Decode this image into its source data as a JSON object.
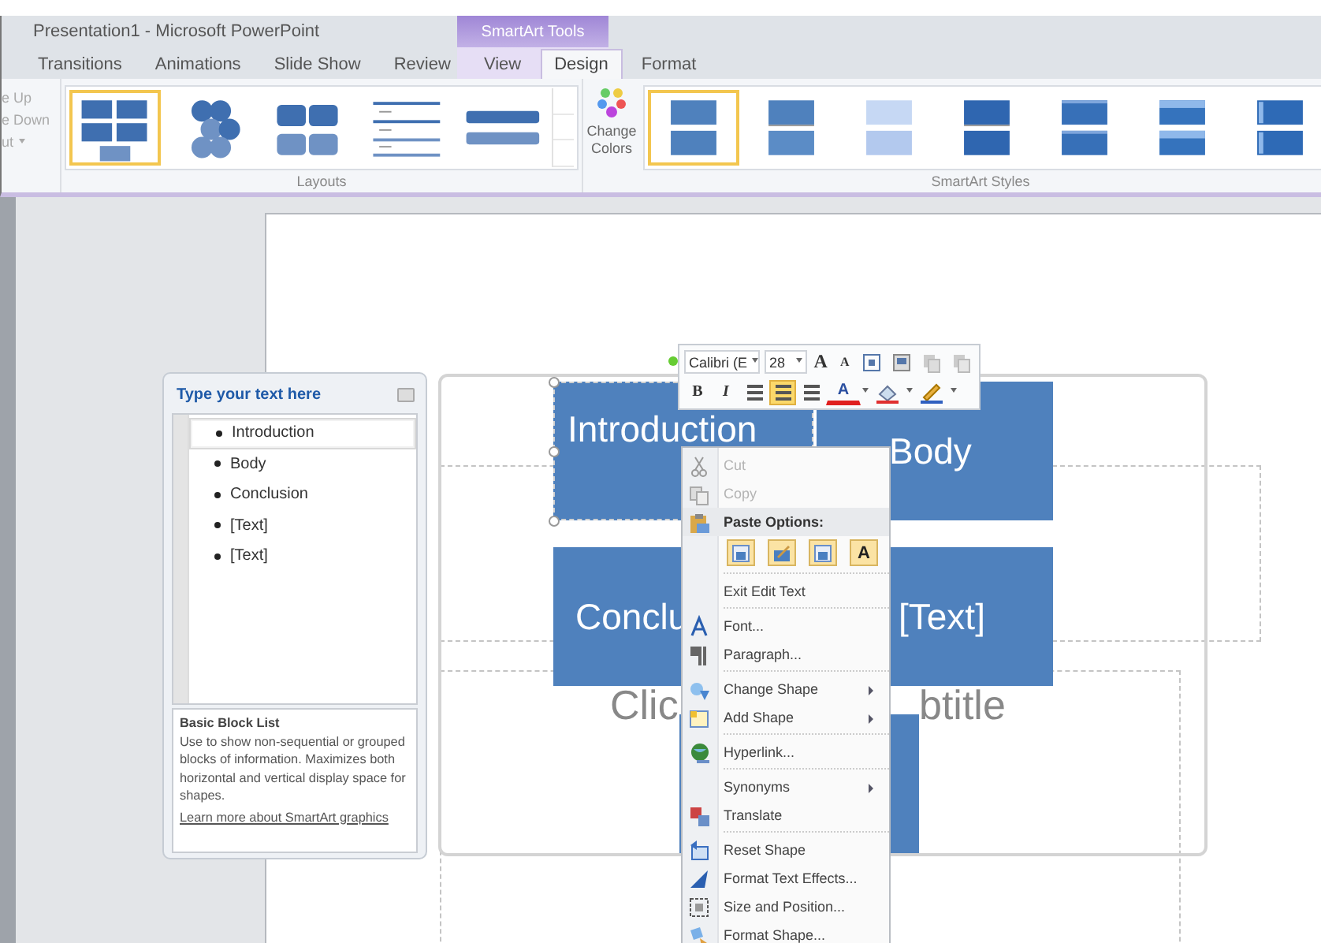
{
  "window": {
    "title": "Presentation1 - Microsoft PowerPoint",
    "context_group": "SmartArt Tools"
  },
  "tabs": [
    {
      "label": "Transitions",
      "selected": false
    },
    {
      "label": "Animations",
      "selected": false
    },
    {
      "label": "Slide Show",
      "selected": false
    },
    {
      "label": "Review",
      "selected": false
    },
    {
      "label": "View",
      "selected": false
    },
    {
      "label": "Design",
      "selected": true
    },
    {
      "label": "Format",
      "selected": false
    }
  ],
  "ribbon": {
    "left_group": [
      {
        "label": "e Up",
        "dropdown": false
      },
      {
        "label": "e Down",
        "dropdown": false
      },
      {
        "label": "ut",
        "dropdown": true
      }
    ],
    "layouts": {
      "label": "Layouts",
      "items": [
        {
          "kind": "block-list",
          "selected": true
        },
        {
          "kind": "hexagons",
          "selected": false
        },
        {
          "kind": "grid",
          "selected": false
        },
        {
          "kind": "lines",
          "selected": false
        },
        {
          "kind": "bars",
          "selected": false
        }
      ]
    },
    "change_colors": {
      "label": "Change Colors"
    },
    "styles": {
      "label": "SmartArt Styles",
      "items": [
        {
          "kind": "flat",
          "selected": true
        },
        {
          "kind": "subtle",
          "selected": false
        },
        {
          "kind": "light",
          "selected": false
        },
        {
          "kind": "dark",
          "selected": false
        },
        {
          "kind": "bevel",
          "selected": false
        },
        {
          "kind": "shine",
          "selected": false
        },
        {
          "kind": "edge",
          "selected": false
        }
      ]
    }
  },
  "text_pane": {
    "title": "Type your text here",
    "items": [
      {
        "text": "Introduction",
        "selected": true
      },
      {
        "text": "Body",
        "selected": false
      },
      {
        "text": "Conclusion",
        "selected": false
      },
      {
        "text": "[Text]",
        "selected": false
      },
      {
        "text": "[Text]",
        "selected": false
      }
    ],
    "description_title": "Basic Block List",
    "description": "Use to show non-sequential or grouped blocks of information. Maximizes both horizontal and vertical display space for shapes.",
    "link": "Learn more about SmartArt graphics"
  },
  "slide": {
    "blocks": [
      {
        "text": "Introduction",
        "selected": true
      },
      {
        "text": "Body",
        "selected": false
      },
      {
        "text": "Conclu",
        "selected": false
      },
      {
        "text": "[Text]",
        "selected": false
      },
      {
        "selected": false
      }
    ],
    "subtitle_fragments": [
      "Clic",
      "btitle"
    ]
  },
  "mini_toolbar": {
    "font": "Calibri (E",
    "size": "28",
    "row1": [
      {
        "kind": "grow",
        "label": "A"
      },
      {
        "kind": "shrink",
        "label": "A"
      },
      {
        "kind": "icon"
      },
      {
        "kind": "icon"
      },
      {
        "kind": "icon"
      },
      {
        "kind": "icon"
      }
    ],
    "row2": [
      {
        "kind": "bold",
        "label": "B"
      },
      {
        "kind": "italic",
        "label": "I"
      },
      {
        "kind": "align",
        "selected": false
      },
      {
        "kind": "align",
        "selected": true
      },
      {
        "kind": "align",
        "selected": false
      },
      {
        "kind": "font-color",
        "label": "A"
      },
      {
        "kind": "fill"
      },
      {
        "kind": "pen"
      }
    ]
  },
  "context_menu": {
    "groups": [
      [
        {
          "kind": "item",
          "label": "Cut",
          "disabled": true,
          "submenu": false
        },
        {
          "kind": "item",
          "label": "Copy",
          "disabled": true,
          "submenu": false
        },
        {
          "kind": "header",
          "label": "Paste Options:"
        },
        {
          "kind": "paste-row",
          "buttons": [
            {
              "kind": "picture"
            },
            {
              "kind": "brush"
            },
            {
              "kind": "picture"
            },
            {
              "kind": "text",
              "label": "A"
            }
          ]
        }
      ],
      [
        {
          "kind": "item",
          "label": "Exit Edit Text",
          "disabled": false,
          "submenu": false
        }
      ],
      [
        {
          "kind": "item",
          "label": "Font...",
          "disabled": false,
          "submenu": false
        },
        {
          "kind": "item",
          "label": "Paragraph...",
          "disabled": false,
          "submenu": false
        }
      ],
      [
        {
          "kind": "item",
          "label": "Change Shape",
          "disabled": false,
          "submenu": true
        },
        {
          "kind": "item",
          "label": "Add Shape",
          "disabled": false,
          "submenu": true
        }
      ],
      [
        {
          "kind": "item",
          "label": "Hyperlink...",
          "disabled": false,
          "submenu": false
        }
      ],
      [
        {
          "kind": "item",
          "label": "Synonyms",
          "disabled": false,
          "submenu": true
        },
        {
          "kind": "item",
          "label": "Translate",
          "disabled": false,
          "submenu": false
        }
      ],
      [
        {
          "kind": "item",
          "label": "Reset Shape",
          "disabled": false,
          "submenu": false
        },
        {
          "kind": "item",
          "label": "Format Text Effects...",
          "disabled": false,
          "submenu": false
        },
        {
          "kind": "item",
          "label": "Size and Position...",
          "disabled": false,
          "submenu": false
        },
        {
          "kind": "item",
          "label": "Format Shape...",
          "disabled": false,
          "submenu": false
        }
      ]
    ]
  }
}
